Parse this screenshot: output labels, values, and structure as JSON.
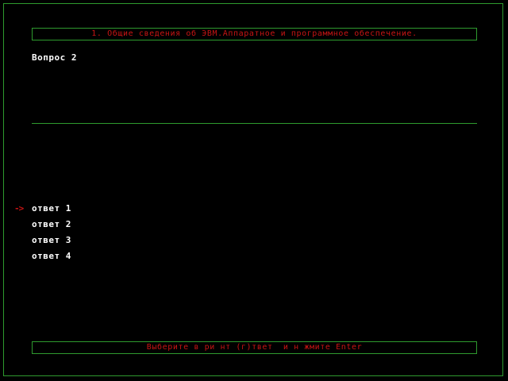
{
  "header": {
    "title": "1. Общие сведения об ЭВМ.Аппаратное и программное обеспечение."
  },
  "question": {
    "label": "Вопрос 2"
  },
  "answers": [
    {
      "label": "ответ 1",
      "selected": true
    },
    {
      "label": "ответ 2",
      "selected": false
    },
    {
      "label": "ответ 3",
      "selected": false
    },
    {
      "label": "ответ 4",
      "selected": false
    }
  ],
  "pointer": "->",
  "status": {
    "text": "Выберите в ри нт (г)твет  и н жмите Enter"
  },
  "colors": {
    "frame": "#2e9a2e",
    "accent_red": "#c81414",
    "text_white": "#ffffff",
    "background": "#000000"
  }
}
